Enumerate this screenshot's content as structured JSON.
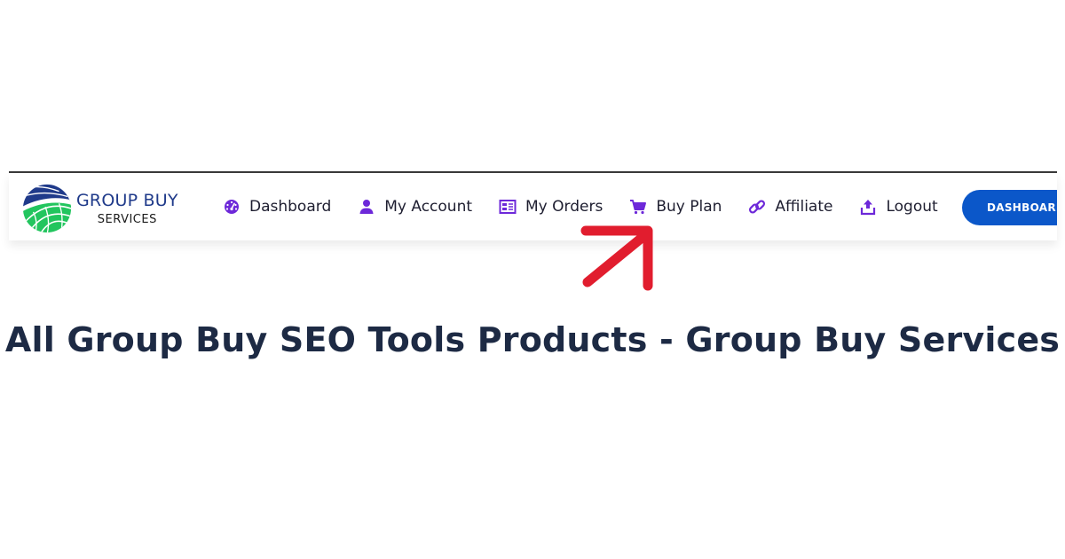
{
  "brand": {
    "title": "GROUP BUY",
    "subtitle": "SERVICES",
    "colors": {
      "title": "#1f3a8a",
      "globe_blue": "#1f3a8a",
      "globe_green": "#22c55e"
    }
  },
  "nav": {
    "items": [
      {
        "label": "Dashboard",
        "icon": "dashboard-gauge-icon"
      },
      {
        "label": "My Account",
        "icon": "user-icon"
      },
      {
        "label": "My Orders",
        "icon": "orders-list-icon"
      },
      {
        "label": "Buy Plan",
        "icon": "cart-icon"
      },
      {
        "label": "Affiliate",
        "icon": "link-icon"
      },
      {
        "label": "Logout",
        "icon": "upload-logout-icon"
      }
    ],
    "icon_color": "#6d28d9",
    "dashboard_button": "DASHBOARD",
    "button_color": "#0b57c9"
  },
  "annotation": {
    "arrow_color": "#e11d2e",
    "points_to": "Buy Plan"
  },
  "main": {
    "title": "All Group Buy SEO Tools Products - Group Buy Services"
  }
}
